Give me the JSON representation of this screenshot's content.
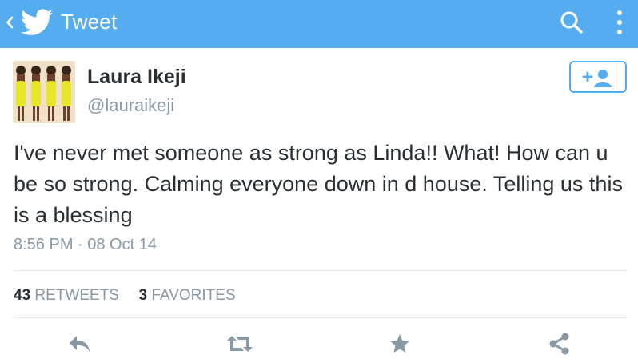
{
  "colors": {
    "brand": "#55acee",
    "text": "#292f33",
    "muted": "#8899a6",
    "action_icon": "#8899a6"
  },
  "header": {
    "title": "Tweet",
    "icons": {
      "back": "chevron-left-icon",
      "logo": "twitter-bird-icon",
      "search": "search-icon",
      "more": "more-vertical-icon"
    }
  },
  "tweet": {
    "author_name": "Laura Ikeji",
    "author_handle": "@lauraikeji",
    "text": "I've never met someone as strong as Linda!! What! How can u be so strong. Calming everyone down in d house. Telling us this is a blessing",
    "timestamp": "8:56 PM · 08 Oct 14"
  },
  "follow_button": {
    "icon": "add-user-icon"
  },
  "stats": {
    "retweets_count": "43",
    "retweets_label": "RETWEETS",
    "favorites_count": "3",
    "favorites_label": "FAVORITES"
  },
  "actions": {
    "reply": "reply-icon",
    "retweet": "retweet-icon",
    "favorite": "star-icon",
    "share": "share-icon"
  }
}
